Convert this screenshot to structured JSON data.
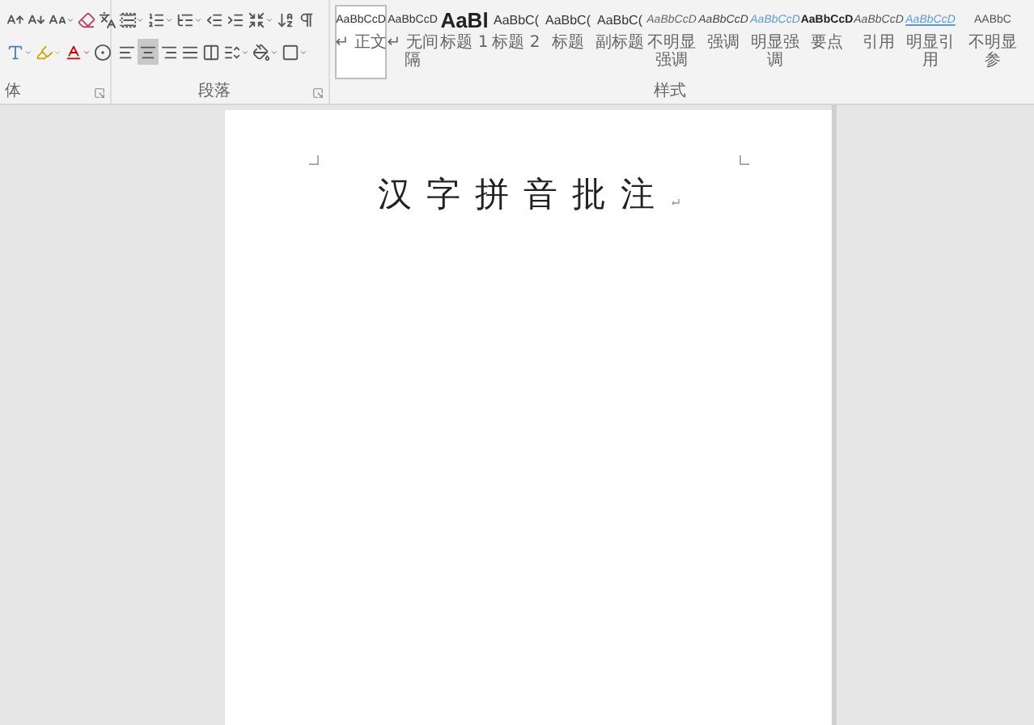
{
  "ribbon": {
    "font_group": {
      "label": "体"
    },
    "paragraph_group": {
      "label": "段落",
      "alignment": [
        {
          "kind": "left",
          "selected": false
        },
        {
          "kind": "center",
          "selected": true
        },
        {
          "kind": "right",
          "selected": false
        },
        {
          "kind": "justify",
          "selected": false
        },
        {
          "kind": "distributed",
          "selected": false
        }
      ]
    },
    "styles_group": {
      "label": "样式",
      "styles": [
        {
          "preview": "AaBbCcD",
          "name": "↵ 正文",
          "kind": "normal",
          "selected": true
        },
        {
          "preview": "AaBbCcD",
          "name": "↵ 无间隔",
          "kind": "normal",
          "selected": false
        },
        {
          "preview": "AaBl",
          "name": "标题 1",
          "kind": "heading1",
          "selected": false
        },
        {
          "preview": "AaBbC(",
          "name": "标题 2",
          "kind": "heading2",
          "selected": false
        },
        {
          "preview": "AaBbC(",
          "name": "标题",
          "kind": "heading2",
          "selected": false
        },
        {
          "preview": "AaBbC(",
          "name": "副标题",
          "kind": "heading2",
          "selected": false
        },
        {
          "preview": "AaBbCcD",
          "name": "不明显强调",
          "kind": "subtle",
          "selected": false
        },
        {
          "preview": "AaBbCcD",
          "name": "强调",
          "kind": "emphasis",
          "selected": false
        },
        {
          "preview": "AaBbCcD",
          "name": "明显强调",
          "kind": "intense",
          "selected": false
        },
        {
          "preview": "AaBbCcD",
          "name": "要点",
          "kind": "strong",
          "selected": false
        },
        {
          "preview": "AaBbCcD",
          "name": "引用",
          "kind": "quote",
          "selected": false
        },
        {
          "preview": "AaBbCcD",
          "name": "明显引用",
          "kind": "intense_quote",
          "selected": false
        },
        {
          "preview": "AABbC",
          "name": "不明显参",
          "kind": "smallcaps",
          "selected": false
        }
      ]
    }
  },
  "document": {
    "text": "汉字拼音批注"
  }
}
